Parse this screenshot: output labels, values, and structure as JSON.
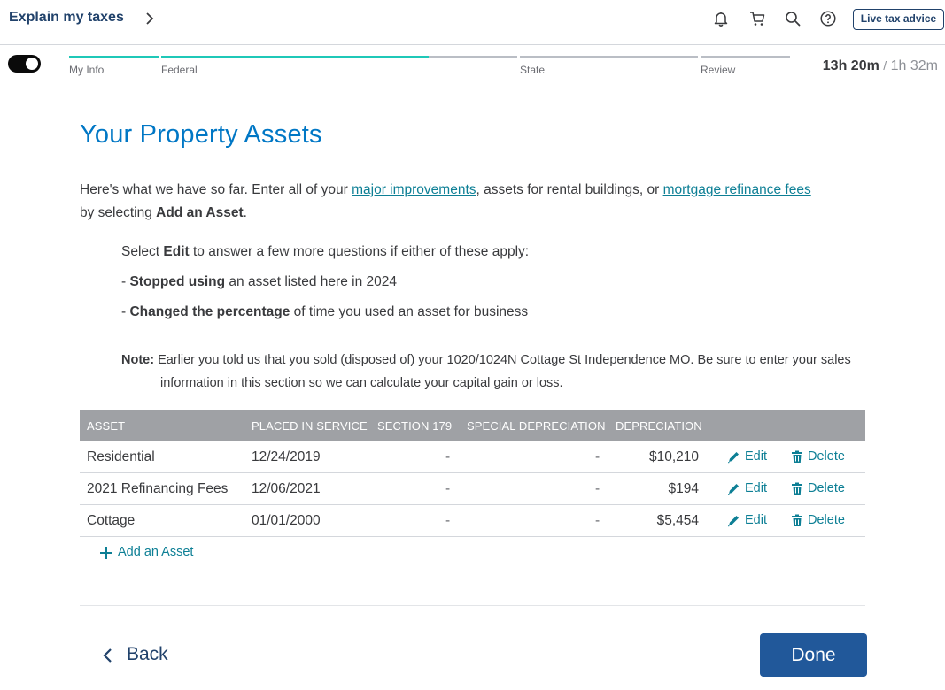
{
  "header": {
    "explain_label": "Explain my taxes",
    "live_help_label": "Live tax advice",
    "icons": [
      "bell-icon",
      "cart-icon",
      "search-icon",
      "help-icon"
    ]
  },
  "progress": {
    "steps": [
      {
        "label": "My Info",
        "fill": 1.0
      },
      {
        "label": "Federal",
        "fill": 0.75
      },
      {
        "label": "State",
        "fill": 0.0
      },
      {
        "label": "Review",
        "fill": 0.0
      }
    ],
    "timer_elapsed": "13h 20m",
    "timer_sep": "/",
    "timer_total": "1h 32m",
    "accent_color": "#1fc8b8"
  },
  "page": {
    "title": "Your Property Assets",
    "intro_1": "Here's what we have so far. Enter all of your ",
    "link_improvements": "major improvements",
    "intro_2": ", assets for rental buildings, or ",
    "link_refinance": "mortgage refinance fees",
    "intro_3": "by selecting ",
    "intro_bold": "Add an Asset",
    "intro_4": ".",
    "select_prefix": "Select ",
    "select_bold": "Edit",
    "select_suffix": " to answer a few more questions if either of these apply:",
    "bullet1_prefix": "- ",
    "bullet1_bold": "Stopped using",
    "bullet1_suffix": " an asset listed here in 2024",
    "bullet2_prefix": "- ",
    "bullet2_bold": "Changed the percentage",
    "bullet2_suffix": " of time you used an asset for business",
    "note_label": "Note:",
    "note_text": " Earlier you told us that you sold (disposed of) your 1020/1024N Cottage St Independence MO. Be sure to enter your sales information in this section so we can calculate your capital gain or loss."
  },
  "table": {
    "headers": [
      "ASSET",
      "PLACED IN SERVICE",
      "SECTION 179",
      "SPECIAL DEPRECIATION",
      "DEPRECIATION"
    ],
    "rows": [
      {
        "asset": "Residential",
        "placed": "12/24/2019",
        "s179": "-",
        "special": "-",
        "depreciation": "$10,210"
      },
      {
        "asset": "2021 Refinancing Fees",
        "placed": "12/06/2021",
        "s179": "-",
        "special": "-",
        "depreciation": "$194"
      },
      {
        "asset": "Cottage",
        "placed": "01/01/2000",
        "s179": "-",
        "special": "-",
        "depreciation": "$5,454"
      }
    ],
    "edit_label": "Edit",
    "delete_label": "Delete",
    "add_label": "Add an Asset"
  },
  "footer": {
    "back_label": "Back",
    "done_label": "Done"
  }
}
